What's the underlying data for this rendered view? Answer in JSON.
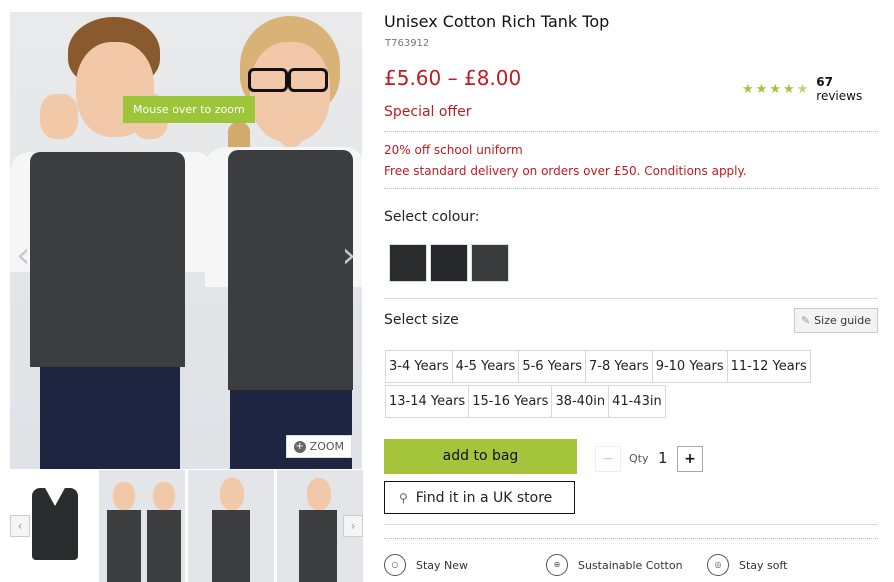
{
  "gallery": {
    "tooltip": "Mouse over to zoom",
    "prev_arrow": "‹",
    "next_arrow": "›",
    "zoom_label": "ZOOM",
    "thumb_prev": "‹",
    "thumb_next": "›"
  },
  "product": {
    "title": "Unisex Cotton Rich Tank Top",
    "code": "T763912",
    "price": "£5.60 – £8.00",
    "rating_stars": 4.5,
    "reviews_count": "67",
    "reviews_label": "reviews",
    "special_offer": "Special offer",
    "promo_1": "20% off school uniform",
    "promo_2": "Free standard delivery on orders over £50. Conditions apply."
  },
  "colour": {
    "label": "Select colour:",
    "swatches": [
      "#2a2b2d",
      "#25272a",
      "#3a3b3d"
    ]
  },
  "size": {
    "label": "Select size",
    "guide_label": "Size guide",
    "row1": [
      "3-4 Years",
      "4-5 Years",
      "5-6 Years",
      "7-8 Years",
      "9-10 Years",
      "11-12 Years"
    ],
    "row2": [
      "13-14 Years",
      "15-16 Years",
      "38-40in",
      "41-43in"
    ]
  },
  "purchase": {
    "add_to_bag": "add to bag",
    "qty_minus": "−",
    "qty_label": "Qty",
    "qty_value": "1",
    "qty_plus": "+",
    "find_store": "Find it in a UK store"
  },
  "features": [
    {
      "icon": "stay-new-icon",
      "label": "Stay New"
    },
    {
      "icon": "globe-icon",
      "label": "Sustainable Cotton"
    },
    {
      "icon": "stay-soft-icon",
      "label": "Stay soft"
    }
  ],
  "colors": {
    "accent_red": "#c21a1f",
    "accent_green": "#a3c43b"
  }
}
